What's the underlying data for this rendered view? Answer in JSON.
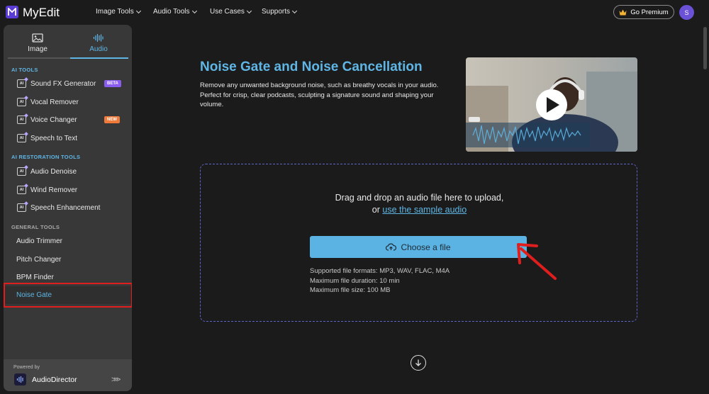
{
  "header": {
    "brand": "MyEdit",
    "nav": [
      {
        "label": "Image Tools"
      },
      {
        "label": "Audio Tools"
      },
      {
        "label": "Use Cases"
      },
      {
        "label": "Supports"
      }
    ],
    "premium_label": "Go Premium",
    "avatar_initial": "S"
  },
  "sidebar": {
    "tabs": [
      {
        "label": "Image",
        "icon": "image-icon"
      },
      {
        "label": "Audio",
        "icon": "audio-wave-icon",
        "active": true
      }
    ],
    "sections": {
      "ai_tools": "AI TOOLS",
      "ai_restoration": "AI RESTORATION TOOLS",
      "general": "GENERAL TOOLS"
    },
    "ai_tools": [
      {
        "label": "Sound FX Generator",
        "badge": "BETA"
      },
      {
        "label": "Vocal Remover"
      },
      {
        "label": "Voice Changer",
        "badge": "NEW"
      },
      {
        "label": "Speech to Text"
      }
    ],
    "restoration_tools": [
      {
        "label": "Audio Denoise"
      },
      {
        "label": "Wind Remover"
      },
      {
        "label": "Speech Enhancement"
      }
    ],
    "general_tools": [
      {
        "label": "Audio Trimmer"
      },
      {
        "label": "Pitch Changer"
      },
      {
        "label": "BPM Finder"
      },
      {
        "label": "Noise Gate",
        "active": true
      }
    ],
    "powered_by": "Powered by",
    "powered_app": "AudioDirector"
  },
  "main": {
    "title": "Noise Gate and Noise Cancellation",
    "description": "Remove any unwanted background noise, such as breathy vocals in your audio. Perfect for crisp, clear podcasts, sculpting a signature sound and shaping your volume.",
    "upload": {
      "line1": "Drag and drop an audio file here to upload,",
      "line2_prefix": "or",
      "sample_link": "use the sample audio",
      "button": "Choose a file",
      "formats": "Supported file formats: MP3, WAV, FLAC, M4A",
      "duration": "Maximum file duration: 10 min",
      "size": "Maximum file size: 100 MB"
    }
  },
  "colors": {
    "accent": "#5fb6e5",
    "beta_badge": "#8a5cf0",
    "new_badge": "#f07a3a",
    "highlight_box": "#e01e1e",
    "annotation_arrow": "#e01e1e"
  }
}
